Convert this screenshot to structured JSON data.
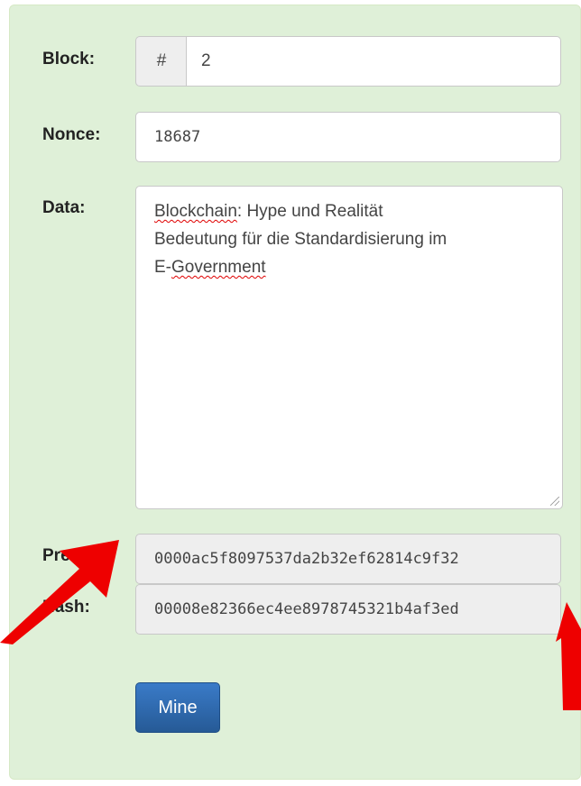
{
  "labels": {
    "block": "Block:",
    "nonce": "Nonce:",
    "data": "Data:",
    "prev": "Prev:",
    "hash": "Hash:"
  },
  "block": {
    "addon": "#",
    "value": "2"
  },
  "nonce": {
    "value": "18687"
  },
  "data": {
    "word1": "Blockchain",
    "rest1": ": Hype und Realität",
    "line2": "Bedeutung für die Standardisierung im",
    "line3_prefix": "E-",
    "word2": "Government"
  },
  "prev": {
    "value": "0000ac5f8097537da2b32ef62814c9f32"
  },
  "hash": {
    "value": "00008e82366ec4ee8978745321b4af3ed"
  },
  "mine_label": "Mine",
  "colors": {
    "panel_bg": "#dff0d8",
    "button": "#337ab7",
    "arrow": "#ee0000"
  }
}
